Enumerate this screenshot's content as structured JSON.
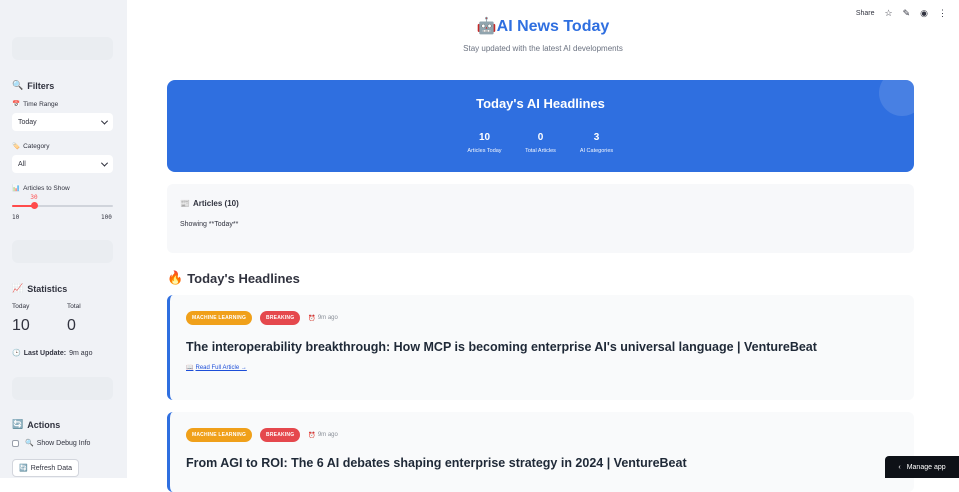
{
  "toolbar": {
    "share_label": "Share",
    "star_icon": "☆",
    "edit_icon": "✎",
    "github_icon": "◉",
    "more_icon": "⋮"
  },
  "sidebar": {
    "filters_heading": "Filters",
    "filters_icon": "🔍",
    "time_range_label": "Time Range",
    "time_range_icon": "📅",
    "time_range_value": "Today",
    "category_label": "Category",
    "category_icon": "🏷️",
    "category_value": "All",
    "articles_label": "Articles to Show",
    "articles_icon": "📊",
    "slider": {
      "value": "30",
      "min": "10",
      "max": "100",
      "fraction": 0.222
    },
    "stats_heading": "Statistics",
    "stats_icon": "📈",
    "today_label": "Today",
    "today_value": "10",
    "total_label": "Total",
    "total_value": "0",
    "last_update_icon": "🕒",
    "last_update_label": "Last Update:",
    "last_update_value": "9m ago",
    "actions_heading": "Actions",
    "actions_icon": "🔄",
    "debug_icon": "🔍",
    "debug_label": "Show Debug Info",
    "refresh_icon": "🔄",
    "refresh_label": "Refresh Data"
  },
  "header": {
    "title_icon": "🤖",
    "title": "AI News Today",
    "subtitle": "Stay updated with the latest AI developments"
  },
  "hero": {
    "title": "Today's AI Headlines",
    "stats": [
      {
        "value": "10",
        "label": "Articles Today"
      },
      {
        "value": "0",
        "label": "Total Articles"
      },
      {
        "value": "3",
        "label": "AI Categories"
      }
    ]
  },
  "articles_box": {
    "icon": "📰",
    "title": "Articles (10)",
    "showing": "Showing **Today**"
  },
  "headlines": {
    "icon": "🔥",
    "title": "Today's Headlines",
    "cards": [
      {
        "tag1": "MACHINE LEARNING",
        "tag2": "BREAKING",
        "time_icon": "⏰",
        "time": "9m ago",
        "title": "The interoperability breakthrough: How MCP is becoming enterprise AI's universal language | VentureBeat",
        "link_icon": "📖",
        "link": "Read Full Article →"
      },
      {
        "tag1": "MACHINE LEARNING",
        "tag2": "BREAKING",
        "time_icon": "⏰",
        "time": "9m ago",
        "title": "From AGI to ROI: The 6 AI debates shaping enterprise strategy in 2024 | VentureBeat"
      }
    ]
  },
  "manage": {
    "icon": "‹",
    "label": "Manage app"
  },
  "colors": {
    "accent": "#2f6fe0",
    "tag_ml": "#f0a01a",
    "tag_breaking": "#e5484d",
    "slider": "#ff4b4b"
  }
}
